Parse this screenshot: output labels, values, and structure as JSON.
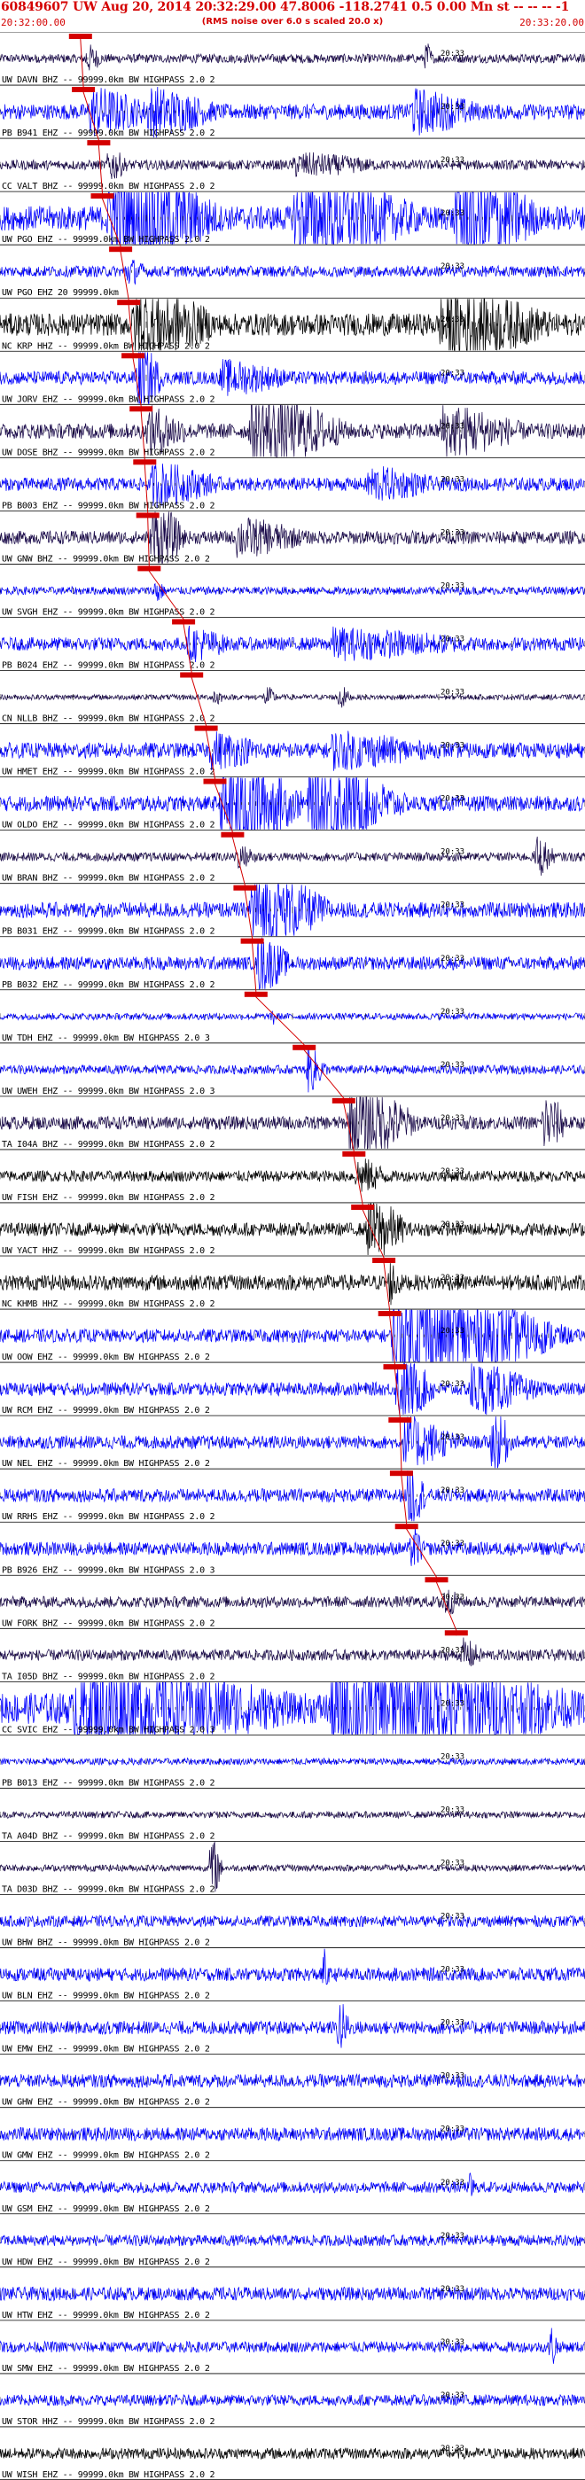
{
  "header": {
    "title": "60849607 UW Aug 20, 2014 20:32:29.00   47.8006 -118.2741  0.5 0.00 Mn st -- -- --  -1",
    "start_time": "20:32:00.00",
    "end_time": "20:33:20.00",
    "note": "(RMS noise over 6.0 s scaled 20.0 x)"
  },
  "colors": {
    "blue": "#0000ff",
    "black": "#000000",
    "dark": "#1a0a4a",
    "pick": "#d40000",
    "grid": "#000000"
  },
  "chart_data": {
    "type": "line",
    "x_range_seconds": [
      0,
      80
    ],
    "x_start_time": "20:32:00.00",
    "x_end_time": "20:33:20.00",
    "minute_mark_label": "20:33",
    "minute_mark_seconds": 60,
    "traces": [
      {
        "label": "UW DAVN BHZ -- 99999.0km BW  HIGHPASS  2.0  2",
        "color": "dark",
        "pick": 11.0,
        "amp": 0.2,
        "bursts": [
          [
            11.5,
            2.5,
            0.6
          ],
          [
            58.0,
            1.2,
            0.9
          ]
        ]
      },
      {
        "label": "PB B941 EHZ -- 99999.0km BW  HIGHPASS  2.0  2",
        "color": "blue",
        "pick": 11.4,
        "amp": 0.35,
        "bursts": [
          [
            12.0,
            9.0,
            0.9
          ],
          [
            20.0,
            10.0,
            0.9
          ],
          [
            56.0,
            10.0,
            0.8
          ]
        ]
      },
      {
        "label": "CC VALT BHZ -- 99999.0km BW  HIGHPASS  2.0  2",
        "color": "dark",
        "pick": 13.5,
        "amp": 0.22,
        "bursts": [
          [
            14.5,
            3.0,
            0.7
          ],
          [
            40.0,
            12.0,
            0.4
          ]
        ]
      },
      {
        "label": "UW PGO EHZ -- 99999.0km BW  HIGHPASS  2.0  2",
        "color": "blue",
        "pick": 14.0,
        "amp": 0.55,
        "bursts": [
          [
            14.5,
            16.0,
            2.5
          ],
          [
            40.0,
            18.0,
            1.6
          ],
          [
            62.0,
            12.0,
            2.5
          ]
        ]
      },
      {
        "label": "UW PGO EHZ  20  99999.0km",
        "color": "blue",
        "pick": 16.5,
        "amp": 0.25,
        "bursts": [
          [
            17.0,
            3.0,
            0.5
          ]
        ]
      },
      {
        "label": "NC KRP HHZ -- 99999.0km BW  HIGHPASS  2.0  2",
        "color": "black",
        "pick": 17.6,
        "amp": 0.5,
        "bursts": [
          [
            18.0,
            12.0,
            1.4
          ],
          [
            60.0,
            16.0,
            1.3
          ]
        ]
      },
      {
        "label": "UW JORV EHZ -- 99999.0km BW  HIGHPASS  2.0  2",
        "color": "blue",
        "pick": 18.2,
        "amp": 0.3,
        "bursts": [
          [
            18.5,
            4.0,
            1.6
          ],
          [
            30.0,
            10.0,
            0.6
          ]
        ]
      },
      {
        "label": "UW DOSE BHZ -- 99999.0km BW  HIGHPASS  2.0  2",
        "color": "dark",
        "pick": 19.3,
        "amp": 0.35,
        "bursts": [
          [
            20.0,
            6.0,
            0.9
          ],
          [
            34.0,
            14.0,
            1.6
          ],
          [
            60.0,
            12.0,
            1.0
          ]
        ]
      },
      {
        "label": "PB B003 EHZ -- 99999.0km BW  HIGHPASS  2.0  2",
        "color": "blue",
        "pick": 19.8,
        "amp": 0.3,
        "bursts": [
          [
            20.5,
            10.0,
            0.8
          ],
          [
            50.0,
            10.0,
            0.6
          ]
        ]
      },
      {
        "label": "UW GNW BHZ -- 99999.0km BW  HIGHPASS  2.0  2",
        "color": "dark",
        "pick": 20.2,
        "amp": 0.3,
        "bursts": [
          [
            20.5,
            5.0,
            1.6
          ],
          [
            32.0,
            10.0,
            0.7
          ]
        ]
      },
      {
        "label": "UW SVGH EHZ -- 99999.0km BW  HIGHPASS  2.0  2",
        "color": "blue",
        "pick": 20.4,
        "amp": 0.18,
        "bursts": [
          [
            21.0,
            1.5,
            0.8
          ]
        ]
      },
      {
        "label": "PB B024 EHZ -- 99999.0km BW  HIGHPASS  2.0  2",
        "color": "blue",
        "pick": 25.1,
        "amp": 0.3,
        "bursts": [
          [
            25.5,
            6.0,
            0.6
          ],
          [
            45.0,
            20.0,
            0.5
          ]
        ]
      },
      {
        "label": "CN NLLB BHZ -- 99999.0km BW  HIGHPASS  2.0  2",
        "color": "dark",
        "pick": 26.2,
        "amp": 0.12,
        "bursts": [
          [
            29.0,
            1.5,
            0.6
          ],
          [
            36.0,
            2.0,
            0.5
          ],
          [
            46.0,
            2.0,
            0.6
          ]
        ]
      },
      {
        "label": "UW HMET EHZ -- 99999.0km BW  HIGHPASS  2.0  2",
        "color": "blue",
        "pick": 28.2,
        "amp": 0.35,
        "bursts": [
          [
            28.5,
            8.0,
            0.6
          ],
          [
            45.0,
            14.0,
            0.6
          ]
        ]
      },
      {
        "label": "UW OLDO EHZ -- 99999.0km BW  HIGHPASS  2.0  2",
        "color": "blue",
        "pick": 29.4,
        "amp": 0.35,
        "bursts": [
          [
            30.0,
            12.0,
            2.4
          ],
          [
            42.0,
            14.0,
            1.8
          ]
        ]
      },
      {
        "label": "UW BRAN BHZ -- 99999.0km BW  HIGHPASS  2.0  2",
        "color": "dark",
        "pick": 31.8,
        "amp": 0.2,
        "bursts": [
          [
            32.0,
            4.0,
            0.4
          ],
          [
            73.0,
            3.0,
            0.9
          ]
        ]
      },
      {
        "label": "PB B031 EHZ -- 99999.0km BW  HIGHPASS  2.0  2",
        "color": "blue",
        "pick": 33.5,
        "amp": 0.35,
        "bursts": [
          [
            34.0,
            12.0,
            1.6
          ]
        ]
      },
      {
        "label": "PB B032 EHZ -- 99999.0km BW  HIGHPASS  2.0  2",
        "color": "blue",
        "pick": 34.5,
        "amp": 0.3,
        "bursts": [
          [
            35.0,
            5.0,
            1.2
          ]
        ]
      },
      {
        "label": "UW TDH EHZ -- 99999.0km BW  HIGHPASS  2.0  3",
        "color": "blue",
        "pick": 35.0,
        "amp": 0.15,
        "bursts": [
          [
            37.0,
            1.0,
            0.5
          ]
        ]
      },
      {
        "label": "UW UWEH EHZ -- 99999.0km BW  HIGHPASS  2.0  3",
        "color": "blue",
        "pick": 41.6,
        "amp": 0.2,
        "bursts": [
          [
            41.8,
            3.0,
            1.0
          ]
        ]
      },
      {
        "label": "TA I04A BHZ -- 99999.0km BW  HIGHPASS  2.0  2",
        "color": "dark",
        "pick": 47.0,
        "amp": 0.3,
        "bursts": [
          [
            47.5,
            10.0,
            1.8
          ],
          [
            74.0,
            4.0,
            1.2
          ]
        ]
      },
      {
        "label": "UW FISH EHZ -- 99999.0km BW  HIGHPASS  2.0  2",
        "color": "black",
        "pick": 48.4,
        "amp": 0.25,
        "bursts": [
          [
            48.5,
            5.0,
            0.7
          ]
        ]
      },
      {
        "label": "UW YACT HHZ -- 99999.0km BW  HIGHPASS  2.0  2",
        "color": "black",
        "pick": 49.6,
        "amp": 0.3,
        "bursts": [
          [
            50.0,
            6.0,
            1.4
          ]
        ]
      },
      {
        "label": "NC KHMB HHZ -- 99999.0km BW  HIGHPASS  2.0  2",
        "color": "black",
        "pick": 52.5,
        "amp": 0.35,
        "bursts": [
          [
            53.0,
            2.0,
            0.9
          ]
        ]
      },
      {
        "label": "UW OOW EHZ -- 99999.0km BW  HIGHPASS  2.0  2",
        "color": "blue",
        "pick": 53.3,
        "amp": 0.3,
        "bursts": [
          [
            53.5,
            25.0,
            2.3
          ]
        ]
      },
      {
        "label": "UW RCM EHZ -- 99999.0km BW  HIGHPASS  2.0  2",
        "color": "blue",
        "pick": 54.0,
        "amp": 0.3,
        "bursts": [
          [
            54.0,
            6.0,
            1.4
          ],
          [
            64.0,
            10.0,
            1.0
          ]
        ]
      },
      {
        "label": "UW NEL EHZ -- 99999.0km BW  HIGHPASS  2.0  2",
        "color": "blue",
        "pick": 54.7,
        "amp": 0.3,
        "bursts": [
          [
            55.0,
            8.0,
            1.0
          ],
          [
            67.0,
            3.0,
            1.8
          ]
        ]
      },
      {
        "label": "UW RRHS EHZ -- 99999.0km BW  HIGHPASS  2.0  2",
        "color": "blue",
        "pick": 54.9,
        "amp": 0.3,
        "bursts": [
          [
            55.5,
            3.0,
            1.4
          ]
        ]
      },
      {
        "label": "PB B926 EHZ -- 99999.0km BW  HIGHPASS  2.0  3",
        "color": "blue",
        "pick": 55.6,
        "amp": 0.3,
        "bursts": [
          [
            56.0,
            2.0,
            1.0
          ]
        ]
      },
      {
        "label": "UW FORK BHZ -- 99999.0km BW  HIGHPASS  2.0  2",
        "color": "dark",
        "pick": 59.7,
        "amp": 0.25,
        "bursts": [
          [
            60.0,
            3.0,
            0.6
          ]
        ]
      },
      {
        "label": "TA I05D BHZ -- 99999.0km BW  HIGHPASS  2.0  2",
        "color": "dark",
        "pick": 62.4,
        "amp": 0.25,
        "bursts": [
          [
            63.0,
            3.0,
            0.6
          ]
        ]
      },
      {
        "label": "CC SVIC EHZ -- 99999.0km BW  HIGHPASS  2.0  3",
        "color": "blue",
        "pick": null,
        "amp": 0.7,
        "bursts": [
          [
            10.0,
            30.0,
            1.8
          ],
          [
            45.0,
            35.0,
            2.0
          ]
        ]
      },
      {
        "label": "PB B013 EHZ -- 99999.0km BW  HIGHPASS  2.0  2",
        "color": "blue",
        "pick": null,
        "amp": 0.15,
        "bursts": []
      },
      {
        "label": "TA A04D BHZ -- 99999.0km BW  HIGHPASS  2.0  2",
        "color": "dark",
        "pick": null,
        "amp": 0.15,
        "bursts": []
      },
      {
        "label": "TA D03D BHZ -- 99999.0km BW  HIGHPASS  2.0  2",
        "color": "dark",
        "pick": null,
        "amp": 0.15,
        "bursts": [
          [
            28.5,
            2.0,
            1.6
          ]
        ]
      },
      {
        "label": "UW BHW BHZ -- 99999.0km BW  HIGHPASS  2.0  2",
        "color": "blue",
        "pick": null,
        "amp": 0.25,
        "bursts": []
      },
      {
        "label": "UW BLN EHZ -- 99999.0km BW  HIGHPASS  2.0  2",
        "color": "blue",
        "pick": null,
        "amp": 0.3,
        "bursts": [
          [
            44.0,
            1.0,
            1.5
          ]
        ]
      },
      {
        "label": "UW EMW EHZ -- 99999.0km BW  HIGHPASS  2.0  2",
        "color": "blue",
        "pick": null,
        "amp": 0.3,
        "bursts": [
          [
            46.0,
            2.0,
            1.2
          ]
        ]
      },
      {
        "label": "UW GHW EHZ -- 99999.0km BW  HIGHPASS  2.0  2",
        "color": "blue",
        "pick": null,
        "amp": 0.3,
        "bursts": []
      },
      {
        "label": "UW GMW EHZ -- 99999.0km BW  HIGHPASS  2.0  2",
        "color": "blue",
        "pick": null,
        "amp": 0.3,
        "bursts": []
      },
      {
        "label": "UW GSM EHZ -- 99999.0km BW  HIGHPASS  2.0  2",
        "color": "blue",
        "pick": null,
        "amp": 0.25,
        "bursts": [
          [
            64.0,
            1.0,
            0.8
          ]
        ]
      },
      {
        "label": "UW HDW EHZ -- 99999.0km BW  HIGHPASS  2.0  2",
        "color": "blue",
        "pick": null,
        "amp": 0.25,
        "bursts": []
      },
      {
        "label": "UW HTW EHZ -- 99999.0km BW  HIGHPASS  2.0  2",
        "color": "blue",
        "pick": null,
        "amp": 0.3,
        "bursts": []
      },
      {
        "label": "UW SMW EHZ -- 99999.0km BW  HIGHPASS  2.0  2",
        "color": "blue",
        "pick": null,
        "amp": 0.25,
        "bursts": [
          [
            75.0,
            1.5,
            1.0
          ]
        ]
      },
      {
        "label": "UW STOR HHZ -- 99999.0km BW  HIGHPASS  2.0  2",
        "color": "blue",
        "pick": null,
        "amp": 0.25,
        "bursts": []
      },
      {
        "label": "UW WISH EHZ -- 99999.0km BW  HIGHPASS  2.0  2",
        "color": "black",
        "pick": null,
        "amp": 0.25,
        "bursts": []
      }
    ]
  }
}
